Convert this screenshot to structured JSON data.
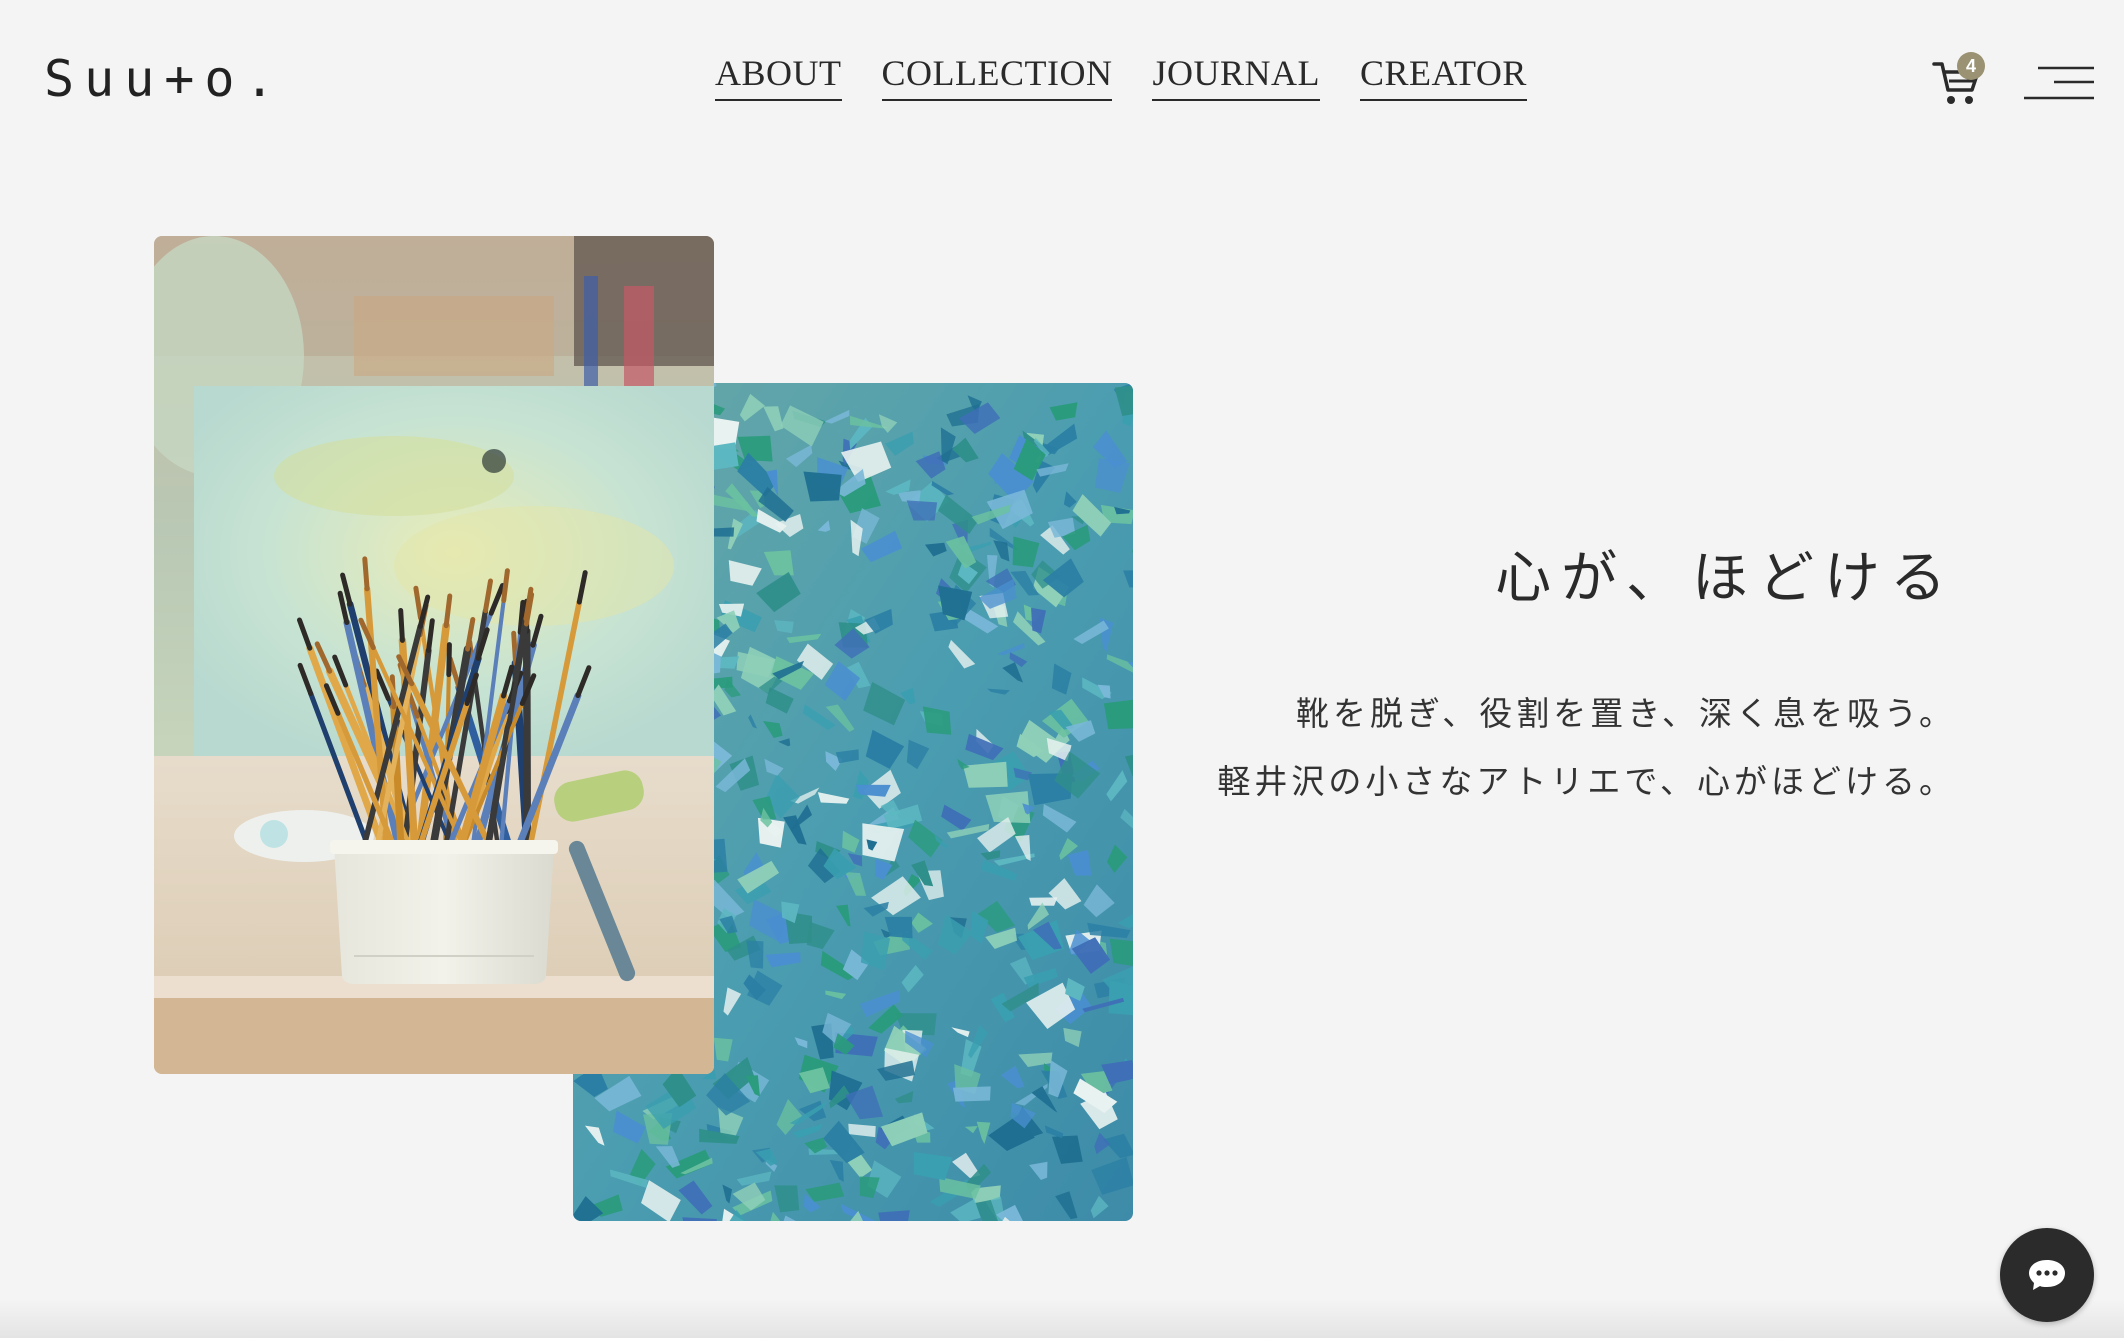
{
  "header": {
    "logo_text": "Suu+o.",
    "nav": [
      {
        "label": "ABOUT"
      },
      {
        "label": "COLLECTION"
      },
      {
        "label": "JOURNAL"
      },
      {
        "label": "CREATOR"
      }
    ],
    "cart_count": "4",
    "cart_icon": "cart-icon",
    "menu_icon": "hamburger-menu-icon"
  },
  "hero": {
    "headline": "心が、ほどける",
    "body_line1": "靴を脱ぎ、役割を置き、深く息を吸う。",
    "body_line2": "軽井沢の小さなアトリエで、心がほどける。",
    "image_front": "paintbrushes-photo",
    "image_back": "blue-mosaic-photo"
  },
  "chat": {
    "icon": "chat-bubble-icon"
  },
  "colors": {
    "background": "#f4f4f4",
    "text": "#2a2a2a",
    "badge": "#9a9273",
    "chat_button": "#2b2b2b"
  }
}
